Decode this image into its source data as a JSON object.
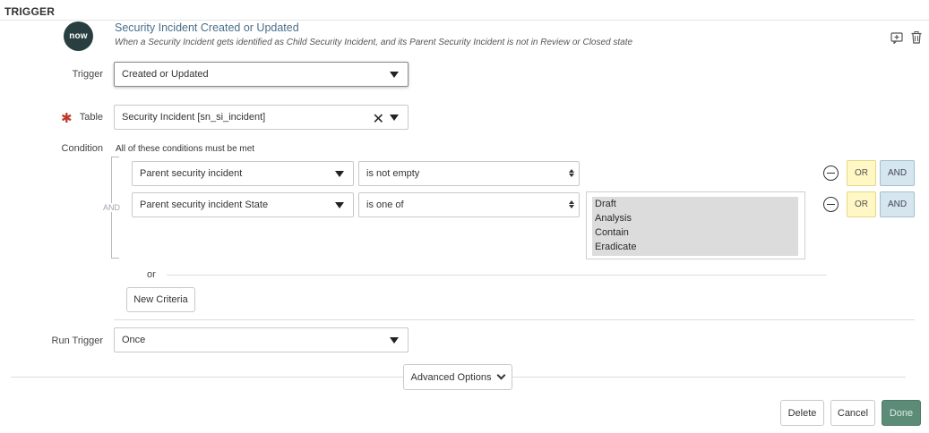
{
  "section_label": "TRIGGER",
  "trigger": {
    "logo_text": "now",
    "title": "Security Incident Created or Updated",
    "description": "When a Security Incident gets identified as Child Security Incident, and its Parent Security Incident is not in Review or Closed state"
  },
  "header_icons": [
    "add-comment-icon",
    "trash-icon"
  ],
  "form": {
    "trigger_label": "Trigger",
    "trigger_value": "Created or Updated",
    "table_label": "Table",
    "table_required": true,
    "table_value": "Security Incident [sn_si_incident]",
    "condition_label": "Condition",
    "condition_hint": "All of these conditions must be met",
    "condition_connector": "AND",
    "conditions": [
      {
        "field": "Parent security incident",
        "operator": "is not empty",
        "or_label": "OR",
        "and_label": "AND"
      },
      {
        "field": "Parent security incident State",
        "operator": "is one of",
        "values": [
          "Draft",
          "Analysis",
          "Contain",
          "Eradicate"
        ],
        "or_label": "OR",
        "and_label": "AND"
      }
    ],
    "or_separator": "or",
    "new_criteria_label": "New Criteria",
    "run_trigger_label": "Run Trigger",
    "run_trigger_value": "Once"
  },
  "advanced_options_label": "Advanced Options",
  "actions": {
    "delete_label": "Delete",
    "cancel_label": "Cancel",
    "done_label": "Done"
  },
  "colors": {
    "accent_title": "#4a6f8a",
    "logo_bg": "#293e40",
    "or_button_bg": "#fff7c4",
    "and_button_bg": "#d6e6ef",
    "done_button_bg": "#5c8c77",
    "required_star": "#c0392b"
  }
}
